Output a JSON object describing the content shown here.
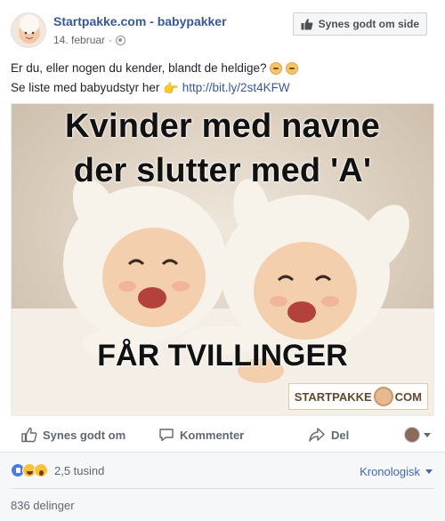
{
  "post": {
    "author": "Startpakke.com - babypakker",
    "date": "14. februar",
    "like_page_label": "Synes godt om side",
    "text_line1": "Er du, eller nogen du kender, blandt de heldige?",
    "text_line2_prefix": "Se liste med babyudstyr her",
    "link": "http://bit.ly/2st4KFW"
  },
  "image": {
    "title_line1": "Kvinder med navne",
    "title_line2": "der slutter med 'A'",
    "caption": "FÅR TVILLINGER",
    "watermark_left": "STARTPAKKE",
    "watermark_right": "COM"
  },
  "actions": {
    "like": "Synes godt om",
    "comment": "Kommenter",
    "share": "Del"
  },
  "stats": {
    "reactions_count": "2,5 tusind",
    "sort_label": "Kronologisk",
    "shares": "836 delinger"
  },
  "colors": {
    "link_blue": "#365899",
    "sort_blue": "#4267b2",
    "muted": "#606770"
  },
  "icons": [
    "thumbs-up-icon",
    "globe-icon",
    "comment-icon",
    "share-arrow-icon",
    "caret-down-icon",
    "like-reaction-icon",
    "haha-reaction-icon",
    "wow-reaction-icon"
  ]
}
